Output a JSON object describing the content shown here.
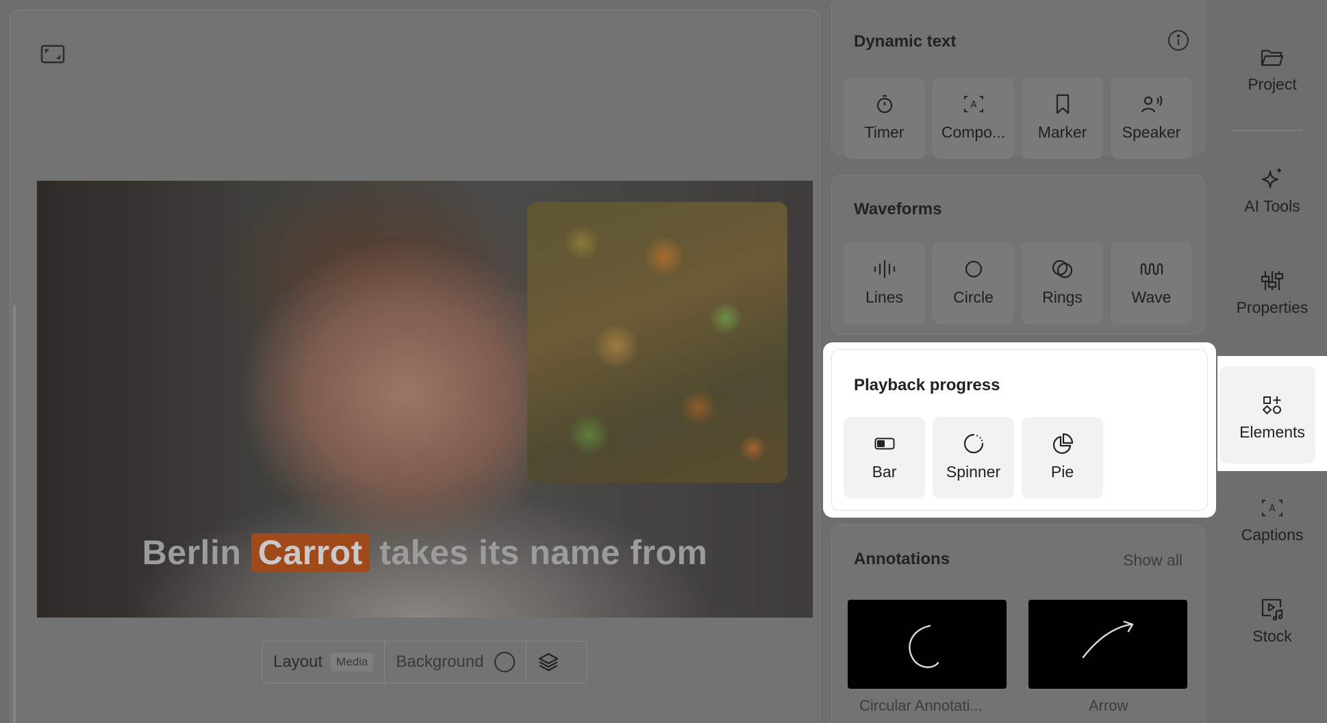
{
  "preview": {
    "caption": {
      "before": "Berlin ",
      "highlight": "Carrot",
      "after": " takes its name from"
    },
    "toolbar": {
      "layout_label": "Layout",
      "layout_badge": "Media",
      "background_label": "Background"
    }
  },
  "panel": {
    "dynamic_text": {
      "title": "Dynamic text",
      "items": [
        {
          "label": "Timer",
          "icon": "timer-icon"
        },
        {
          "label": "Compo...",
          "icon": "component-icon"
        },
        {
          "label": "Marker",
          "icon": "bookmark-icon"
        },
        {
          "label": "Speaker",
          "icon": "speaker-icon"
        }
      ]
    },
    "waveforms": {
      "title": "Waveforms",
      "items": [
        {
          "label": "Lines",
          "icon": "lines-icon"
        },
        {
          "label": "Circle",
          "icon": "circle-icon"
        },
        {
          "label": "Rings",
          "icon": "rings-icon"
        },
        {
          "label": "Wave",
          "icon": "wave-icon"
        }
      ]
    },
    "playback_progress": {
      "title": "Playback progress",
      "items": [
        {
          "label": "Bar",
          "icon": "bar-icon"
        },
        {
          "label": "Spinner",
          "icon": "spinner-icon"
        },
        {
          "label": "Pie",
          "icon": "pie-icon"
        }
      ]
    },
    "annotations": {
      "title": "Annotations",
      "show_all": "Show all",
      "items": [
        {
          "label": "Circular Annotati..."
        },
        {
          "label": "Arrow"
        }
      ]
    }
  },
  "nav": {
    "items": [
      {
        "label": "Project",
        "icon": "folder-icon"
      },
      {
        "label": "AI Tools",
        "icon": "sparkle-icon"
      },
      {
        "label": "Properties",
        "icon": "sliders-icon"
      },
      {
        "label": "Elements",
        "icon": "elements-icon",
        "active": true
      },
      {
        "label": "Captions",
        "icon": "captions-icon"
      },
      {
        "label": "Stock",
        "icon": "stock-icon"
      }
    ]
  },
  "colors": {
    "overlay": "#6e6e6e",
    "highlight": "#ffffff",
    "caption_highlight": "#a04a1c"
  }
}
